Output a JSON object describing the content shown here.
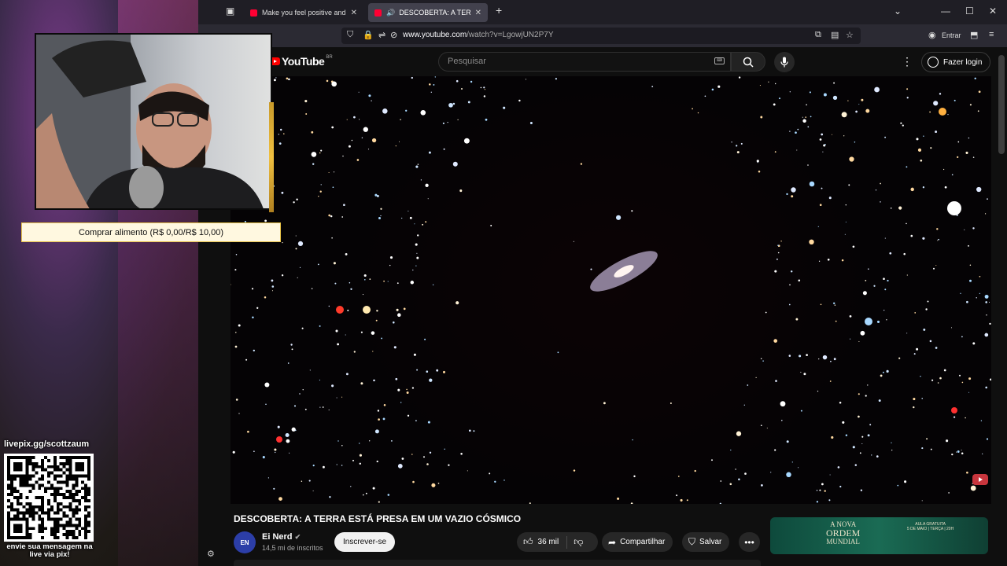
{
  "browser": {
    "tabs": [
      {
        "label": "Make you feel positive and pea",
        "active": false
      },
      {
        "label": "DESCOBERTA: A TERRA EST",
        "active": true
      }
    ],
    "new_tab_icon": "+",
    "url_domain": "www.youtube.com",
    "url_path": "/watch?v=LgowjUN2P7Y",
    "account_label": "Entrar"
  },
  "youtube": {
    "logo_text": "YouTube",
    "country_code": "BR",
    "search_placeholder": "Pesquisar",
    "login_label": "Fazer login",
    "video": {
      "title": "DESCOBERTA: A TERRA ESTÁ PRESA EM UM VAZIO CÓSMICO",
      "channel_name": "Ei Nerd",
      "channel_avatar_text": "EN",
      "subscribers": "14,5 mi de inscritos",
      "subscribe_label": "Inscrever-se",
      "likes": "36 mil",
      "share_label": "Compartilhar",
      "save_label": "Salvar"
    },
    "ad": {
      "title_line1": "A NOVA",
      "title_line2": "ORDEM",
      "title_line3": "MUNDIAL",
      "side_line1": "AULA GRATUITA",
      "side_line2": "5 DE MAIO | TERÇA | 20H"
    },
    "accent_color": "#ff0000"
  },
  "stream_overlay": {
    "alert_text": "Comprar alimento (R$ 0,00/R$ 10,00)",
    "pix_handle": "livepix.gg/scottzaum",
    "pix_message": "envie sua mensagem na live via pix!"
  }
}
